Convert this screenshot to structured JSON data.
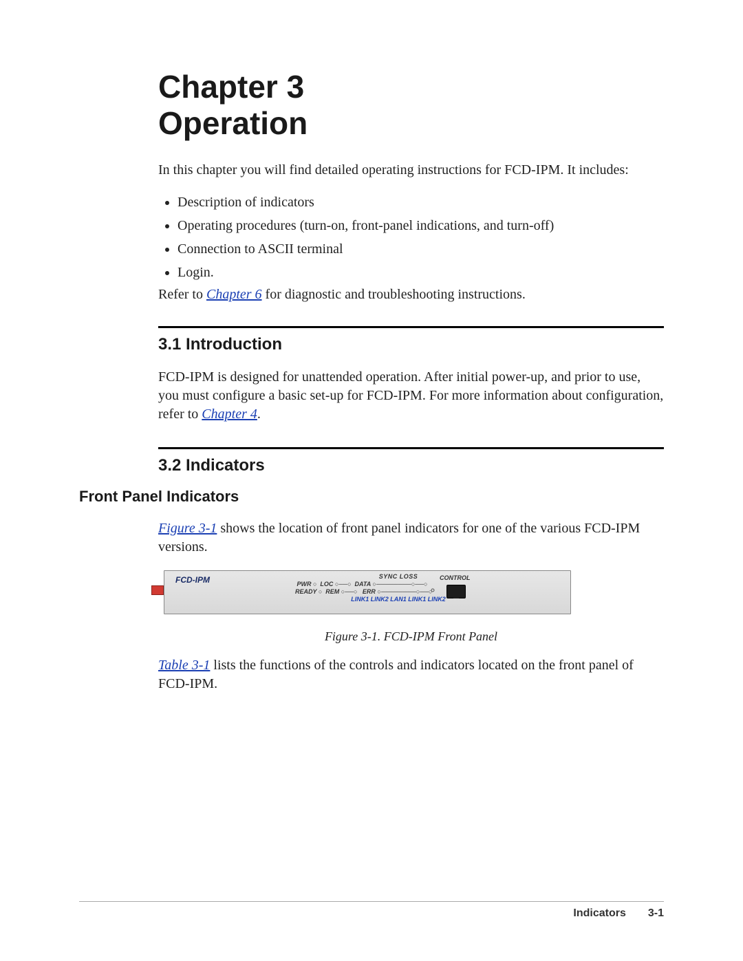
{
  "chapter": {
    "number_line": "Chapter 3",
    "title_line": "Operation",
    "intro": "In this chapter you will find detailed operating instructions for FCD-IPM. It includes:",
    "bullets": [
      "Description of indicators",
      "Operating procedures (turn-on, front-panel indications, and turn-off)",
      "Connection to ASCII terminal",
      "Login."
    ],
    "refer_pre": "Refer to ",
    "refer_link": "Chapter 6",
    "refer_post": " for diagnostic and troubleshooting instructions."
  },
  "section_intro": {
    "heading": "3.1  Introduction",
    "body_pre": "FCD-IPM is designed for unattended operation. After initial power-up, and prior to use, you must configure a basic set-up for FCD-IPM. For more information about configuration, refer to ",
    "body_link": "Chapter 4",
    "body_post": "."
  },
  "section_indicators": {
    "heading": "3.2  Indicators",
    "sub_heading": "Front Panel Indicators",
    "para1_link": "Figure 3-1",
    "para1_post": " shows the location of front panel indicators for one of the various FCD-IPM versions.",
    "fig_caption": "Figure 3-1.  FCD-IPM Front Panel",
    "para2_link": "Table 3-1",
    "para2_post": " lists the functions of the controls and indicators located on the front panel of FCD-IPM."
  },
  "figure": {
    "device_label": "FCD-IPM",
    "sync_loss": "SYNC LOSS",
    "control": "CONTROL",
    "row2": " PWR ○  LOC ○──○  DATA ○────────○──○",
    "row3": "READY ○  REM ○──○   ERR ○────────○──○",
    "links_row": "LINK1  LINK2    LAN1  LINK1 LINK2"
  },
  "footer": {
    "section": "Indicators",
    "page_num": "3-1"
  }
}
